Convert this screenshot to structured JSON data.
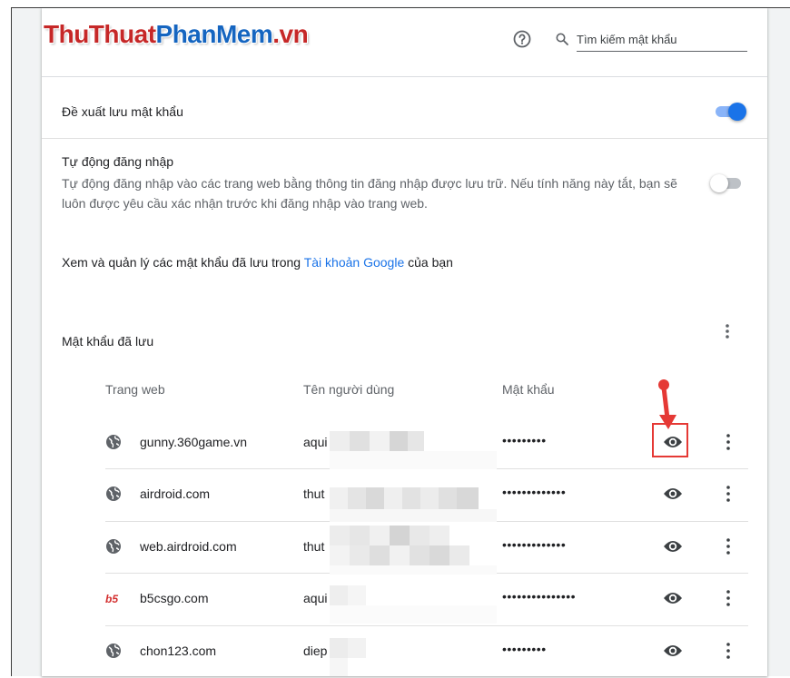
{
  "header": {
    "logo_part1": "ThuThuat",
    "logo_part2": "PhanMem",
    "logo_part3": ".vn",
    "search_placeholder": "Tìm kiếm mật khẩu"
  },
  "settings": {
    "offer_save_label": "Đề xuất lưu mật khẩu",
    "offer_save_enabled": true,
    "auto_signin_title": "Tự động đăng nhập",
    "auto_signin_desc": "Tự động đăng nhập vào các trang web bằng thông tin đăng nhập được lưu trữ. Nếu tính năng này tắt, bạn sẽ luôn được yêu cầu xác nhận trước khi đăng nhập vào trang web.",
    "auto_signin_enabled": false,
    "manage_prefix": "Xem và quản lý các mật khẩu đã lưu trong ",
    "manage_link": "Tài khoản Google",
    "manage_suffix": " của bạn"
  },
  "saved": {
    "title": "Mật khẩu đã lưu",
    "columns": {
      "site": "Trang web",
      "user": "Tên người dùng",
      "password": "Mật khẩu"
    },
    "rows": [
      {
        "site": "gunny.360game.vn",
        "user": "aqui",
        "password": "•••••••••",
        "icon": "globe-icon"
      },
      {
        "site": "airdroid.com",
        "user": "thut",
        "password": "•••••••••••••",
        "icon": "globe-icon"
      },
      {
        "site": "web.airdroid.com",
        "user": "thut",
        "password": "•••••••••••••",
        "icon": "globe-icon"
      },
      {
        "site": "b5csgo.com",
        "user": "aqui",
        "password": "•••••••••••••••",
        "icon": "b5-favicon"
      },
      {
        "site": "chon123.com",
        "user": "diep",
        "password": "•••••••••",
        "icon": "globe-icon"
      }
    ]
  },
  "colors": {
    "accent": "#1a73e8",
    "toggle_on_track": "#8ab4f8",
    "annotation_red": "#e53935"
  }
}
